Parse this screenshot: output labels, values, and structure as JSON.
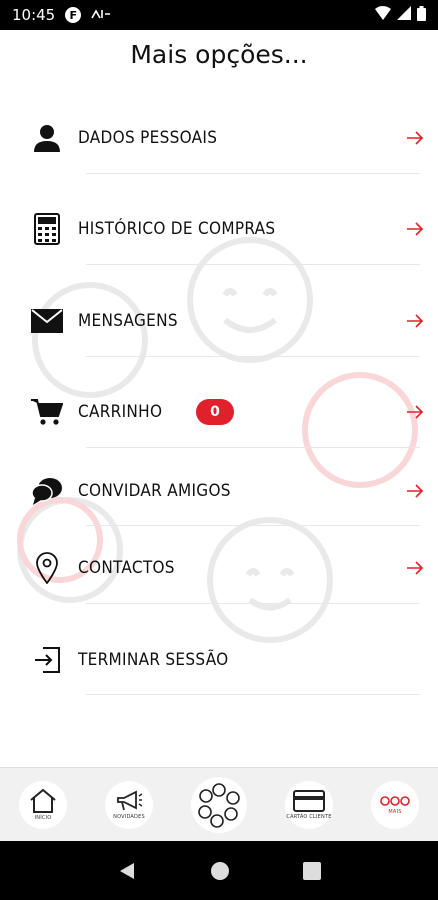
{
  "status": {
    "time": "10:45",
    "icon_f": "F"
  },
  "header": {
    "title": "Mais opções..."
  },
  "menu": [
    {
      "label": "DADOS PESSOAIS",
      "icon": "person-icon"
    },
    {
      "label": "HISTÓRICO DE COMPRAS",
      "icon": "calculator-icon"
    },
    {
      "label": "MENSAGENS",
      "icon": "envelope-icon"
    },
    {
      "label": "CARRINHO",
      "icon": "cart-icon",
      "badge": "0"
    },
    {
      "label": "CONVIDAR AMIGOS",
      "icon": "chat-bubbles-icon"
    },
    {
      "label": "CONTACTOS",
      "icon": "location-pin-icon"
    },
    {
      "label": "TERMINAR SESSÃO",
      "icon": "logout-icon"
    }
  ],
  "tabs": [
    {
      "label": "INÍCIO",
      "icon": "home-icon"
    },
    {
      "label": "NOVIDADES",
      "icon": "megaphone-icon"
    },
    {
      "label": "",
      "icon": "faces-logo-icon"
    },
    {
      "label": "CARTÃO CLIENTE",
      "icon": "card-icon"
    },
    {
      "label": "MAIS",
      "icon": "more-icon"
    }
  ],
  "colors": {
    "accent": "#e0202a",
    "text": "#111111"
  }
}
